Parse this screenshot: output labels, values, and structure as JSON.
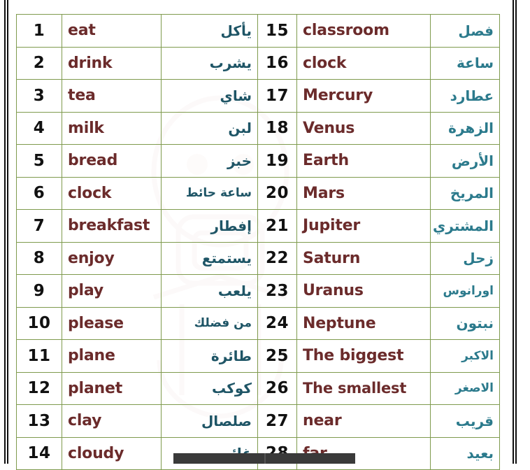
{
  "document": {
    "kind": "vocabulary-table",
    "columns": 6,
    "row_count": 14,
    "entry_count": 28
  },
  "colors": {
    "table_border": "#7f9b4e",
    "english_text": "#6b2b2b",
    "arabic_text_left": "#1e5566",
    "arabic_text_right": "#2b7a8c",
    "number_text": "#111111",
    "page_rule": "#0e0e0e",
    "scrollbar_thumb": "#3a3a3a"
  },
  "rows": [
    {
      "left": {
        "num": "1",
        "english": "eat",
        "arabic": "يأكل"
      },
      "right": {
        "num": "15",
        "english": "classroom",
        "arabic": "فصل"
      }
    },
    {
      "left": {
        "num": "2",
        "english": "drink",
        "arabic": "يشرب"
      },
      "right": {
        "num": "16",
        "english": "clock",
        "arabic": "ساعة"
      }
    },
    {
      "left": {
        "num": "3",
        "english": "tea",
        "arabic": "شاي"
      },
      "right": {
        "num": "17",
        "english": "Mercury",
        "arabic": "عطارد"
      }
    },
    {
      "left": {
        "num": "4",
        "english": "milk",
        "arabic": "لبن"
      },
      "right": {
        "num": "18",
        "english": "Venus",
        "arabic": "الزهرة"
      }
    },
    {
      "left": {
        "num": "5",
        "english": "bread",
        "arabic": "خبز"
      },
      "right": {
        "num": "19",
        "english": "Earth",
        "arabic": "الأرض"
      }
    },
    {
      "left": {
        "num": "6",
        "english": "clock",
        "arabic": "ساعة حائط"
      },
      "right": {
        "num": "20",
        "english": "Mars",
        "arabic": "المريخ"
      }
    },
    {
      "left": {
        "num": "7",
        "english": "breakfast",
        "arabic": "إفطار"
      },
      "right": {
        "num": "21",
        "english": "Jupiter",
        "arabic": "المشتري"
      }
    },
    {
      "left": {
        "num": "8",
        "english": "enjoy",
        "arabic": "يستمتع"
      },
      "right": {
        "num": "22",
        "english": "Saturn",
        "arabic": "زحل"
      }
    },
    {
      "left": {
        "num": "9",
        "english": "play",
        "arabic": "يلعب"
      },
      "right": {
        "num": "23",
        "english": "Uranus",
        "arabic": "اورانوس"
      }
    },
    {
      "left": {
        "num": "10",
        "english": "please",
        "arabic": "من فضلك"
      },
      "right": {
        "num": "24",
        "english": "Neptune",
        "arabic": "نبتون"
      }
    },
    {
      "left": {
        "num": "11",
        "english": "plane",
        "arabic": "طائرة"
      },
      "right": {
        "num": "25",
        "english": "The biggest",
        "arabic": "الاكبر"
      }
    },
    {
      "left": {
        "num": "12",
        "english": "planet",
        "arabic": "كوكب"
      },
      "right": {
        "num": "26",
        "english": "The smallest",
        "arabic": "الاصغر"
      }
    },
    {
      "left": {
        "num": "13",
        "english": "clay",
        "arabic": "صلصال"
      },
      "right": {
        "num": "27",
        "english": "near",
        "arabic": "قريب"
      }
    },
    {
      "left": {
        "num": "14",
        "english": "cloudy",
        "arabic": "غائم"
      },
      "right": {
        "num": "28",
        "english": "far",
        "arabic": "بعيد"
      }
    }
  ]
}
